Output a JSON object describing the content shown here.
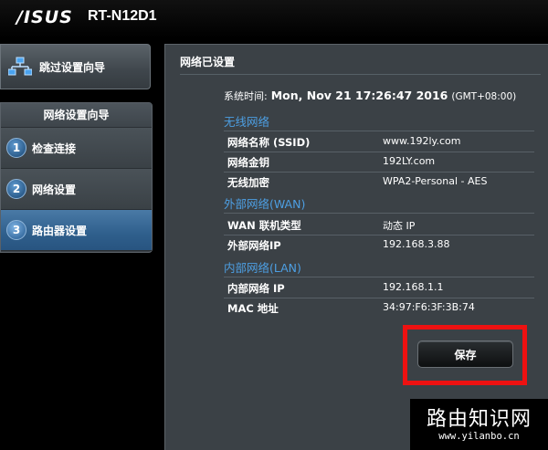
{
  "header": {
    "logo": "/ISUS",
    "model": "RT-N12D1"
  },
  "sidebar": {
    "quick_setup_label": "跳过设置向导",
    "wizard_title": "网络设置向导",
    "steps": [
      {
        "num": "1",
        "label": "检查连接"
      },
      {
        "num": "2",
        "label": "网络设置"
      },
      {
        "num": "3",
        "label": "路由器设置"
      }
    ]
  },
  "main": {
    "title": "网络已设置",
    "system_time_label": "系统时间:",
    "system_time_value": "Mon, Nov 21 17:26:47 2016",
    "system_time_tz": "(GMT+08:00)",
    "wireless": {
      "heading": "无线网络",
      "rows": [
        {
          "key": "网络名称 (SSID)",
          "value": "www.192ly.com"
        },
        {
          "key": "网络金钥",
          "value": "192LY.com"
        },
        {
          "key": "无线加密",
          "value": "WPA2-Personal - AES"
        }
      ]
    },
    "wan": {
      "heading": "外部网络(WAN)",
      "rows": [
        {
          "key": "WAN 联机类型",
          "value": "动态 IP"
        },
        {
          "key": "外部网络IP",
          "value": "192.168.3.88"
        }
      ]
    },
    "lan": {
      "heading": "内部网络(LAN)",
      "rows": [
        {
          "key": "内部网络 IP",
          "value": "192.168.1.1"
        },
        {
          "key": "MAC 地址",
          "value": "34:97:F6:3F:3B:74"
        }
      ]
    },
    "save_label": "保存"
  },
  "watermark": {
    "cn": "路由知识网",
    "en": "www.yilanbo.cn"
  },
  "colors": {
    "section_heading": "#4d9fe3",
    "highlight_frame": "#ee1111",
    "panel_bg": "#3b4146",
    "active_step": "#2f5f8c"
  }
}
